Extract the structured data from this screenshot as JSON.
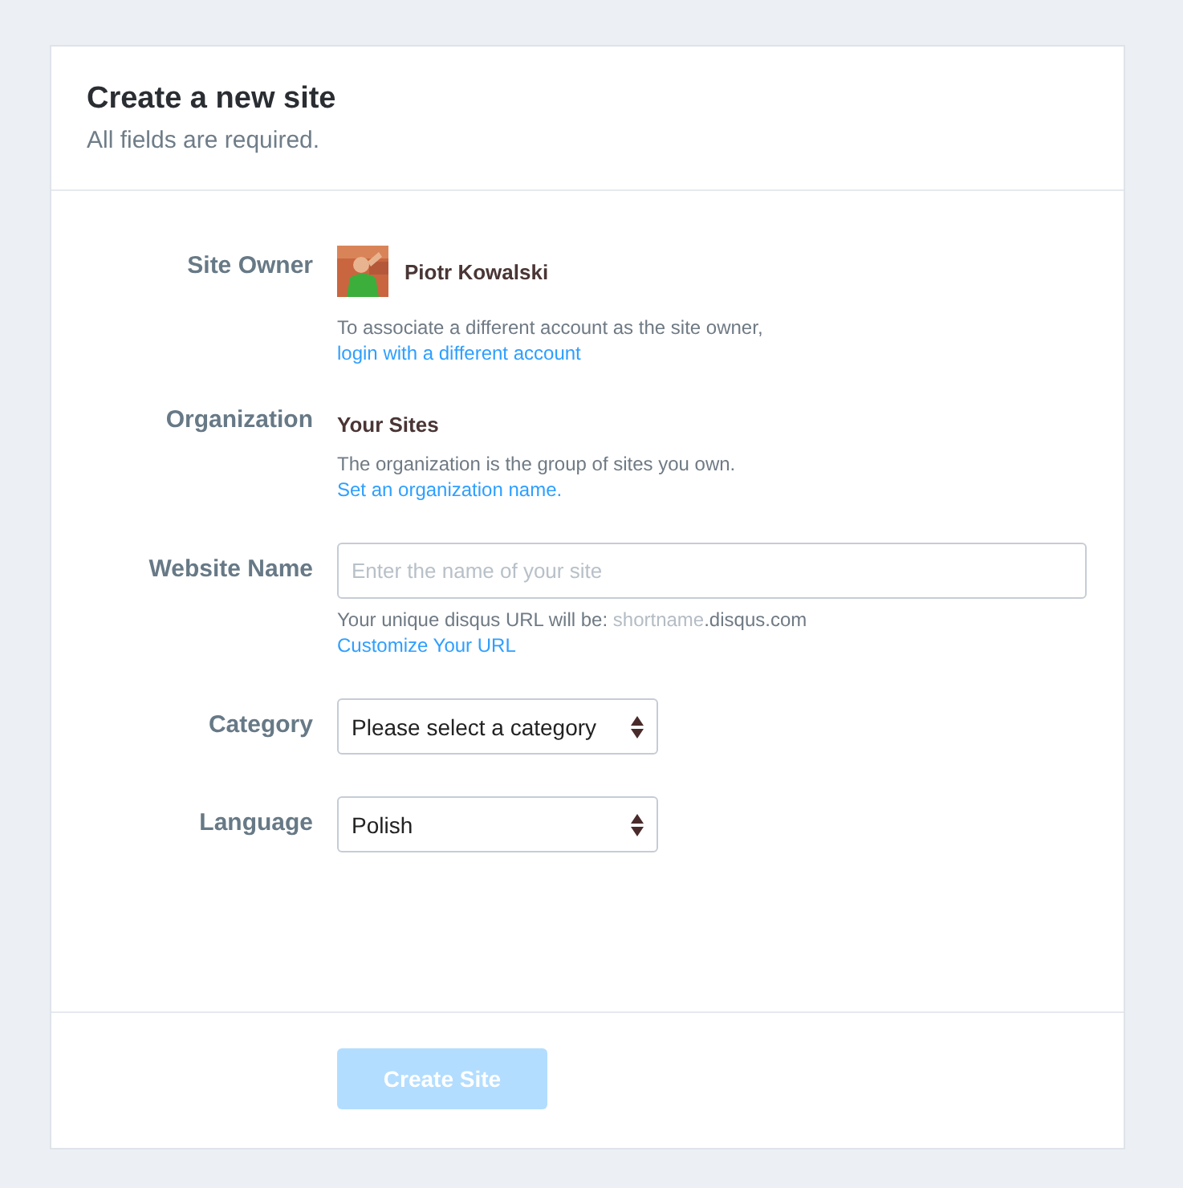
{
  "header": {
    "title": "Create a new site",
    "subtitle": "All fields are required."
  },
  "fields": [
    {
      "kind": "owner",
      "label": "Site Owner",
      "value": "Piotr Kowalski",
      "help": "To associate a different account as the site owner,",
      "link": "login with a different account"
    },
    {
      "kind": "organization",
      "label": "Organization",
      "value": "Your Sites",
      "help": "The organization is the group of sites you own.",
      "link": "Set an organization name."
    },
    {
      "kind": "text",
      "label": "Website Name",
      "placeholder": "Enter the name of your site",
      "help": "Your unique disqus URL will be: ",
      "help_muted": "shortname",
      "help_suffix": ".disqus.com",
      "link": "Customize Your URL"
    },
    {
      "kind": "select",
      "label": "Category",
      "value": "Please select a category"
    },
    {
      "kind": "select",
      "label": "Language",
      "value": "Polish"
    }
  ],
  "submit": {
    "label": "Create Site",
    "disabled": true
  }
}
